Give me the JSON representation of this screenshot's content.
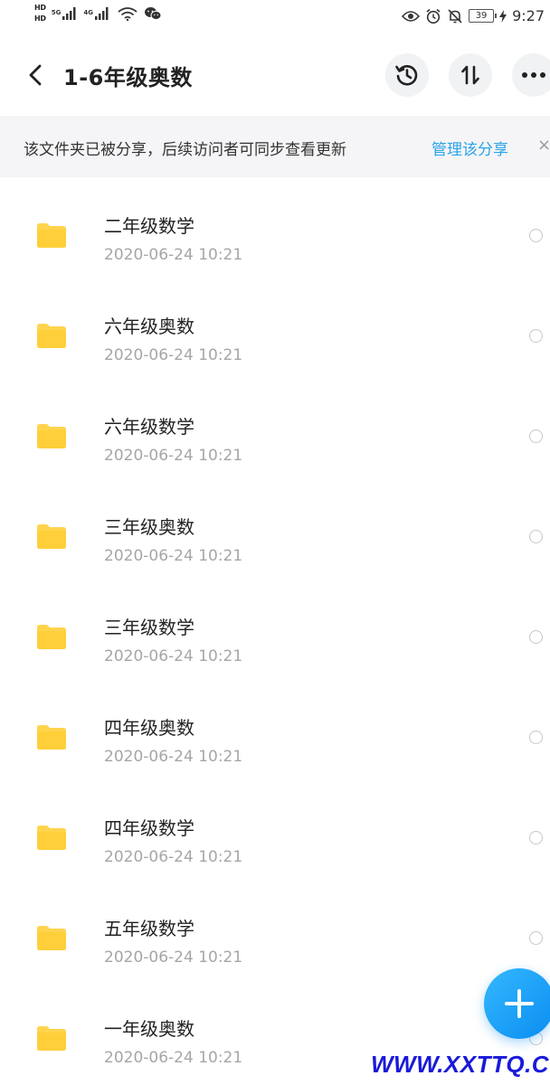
{
  "status_bar": {
    "hd_badge_1": "HD",
    "hd_badge_2": "HD",
    "signal_1_tech": "5G",
    "signal_2_tech": "4G",
    "battery": "39",
    "time": "9:27"
  },
  "header": {
    "title": "1-6年级奥数"
  },
  "share_banner": {
    "text": "该文件夹已被分享，后续访问者可同步查看更新",
    "manage_label": "管理该分享",
    "close_label": "×"
  },
  "files": [
    {
      "name": "二年级数学",
      "date": "2020-06-24  10:21"
    },
    {
      "name": "六年级奥数",
      "date": "2020-06-24  10:21"
    },
    {
      "name": "六年级数学",
      "date": "2020-06-24  10:21"
    },
    {
      "name": "三年级奥数",
      "date": "2020-06-24  10:21"
    },
    {
      "name": "三年级数学",
      "date": "2020-06-24  10:21"
    },
    {
      "name": "四年级奥数",
      "date": "2020-06-24  10:21"
    },
    {
      "name": "四年级数学",
      "date": "2020-06-24  10:21"
    },
    {
      "name": "五年级数学",
      "date": "2020-06-24  10:21"
    },
    {
      "name": "一年级奥数",
      "date": "2020-06-24  10:21"
    }
  ],
  "watermark": "WWW.XXTTQ.COM",
  "icons": {
    "back": "back-arrow-icon",
    "history": "history-icon",
    "sort": "sort-icon",
    "more": "more-icon",
    "folder": "folder-icon",
    "add": "plus-icon"
  },
  "colors": {
    "accent": "#2ba3e8",
    "folder": "#ffd44d",
    "fab": "#1a9bf5",
    "banner_bg": "#f5f5f7",
    "date_text": "#a6a6a6"
  }
}
